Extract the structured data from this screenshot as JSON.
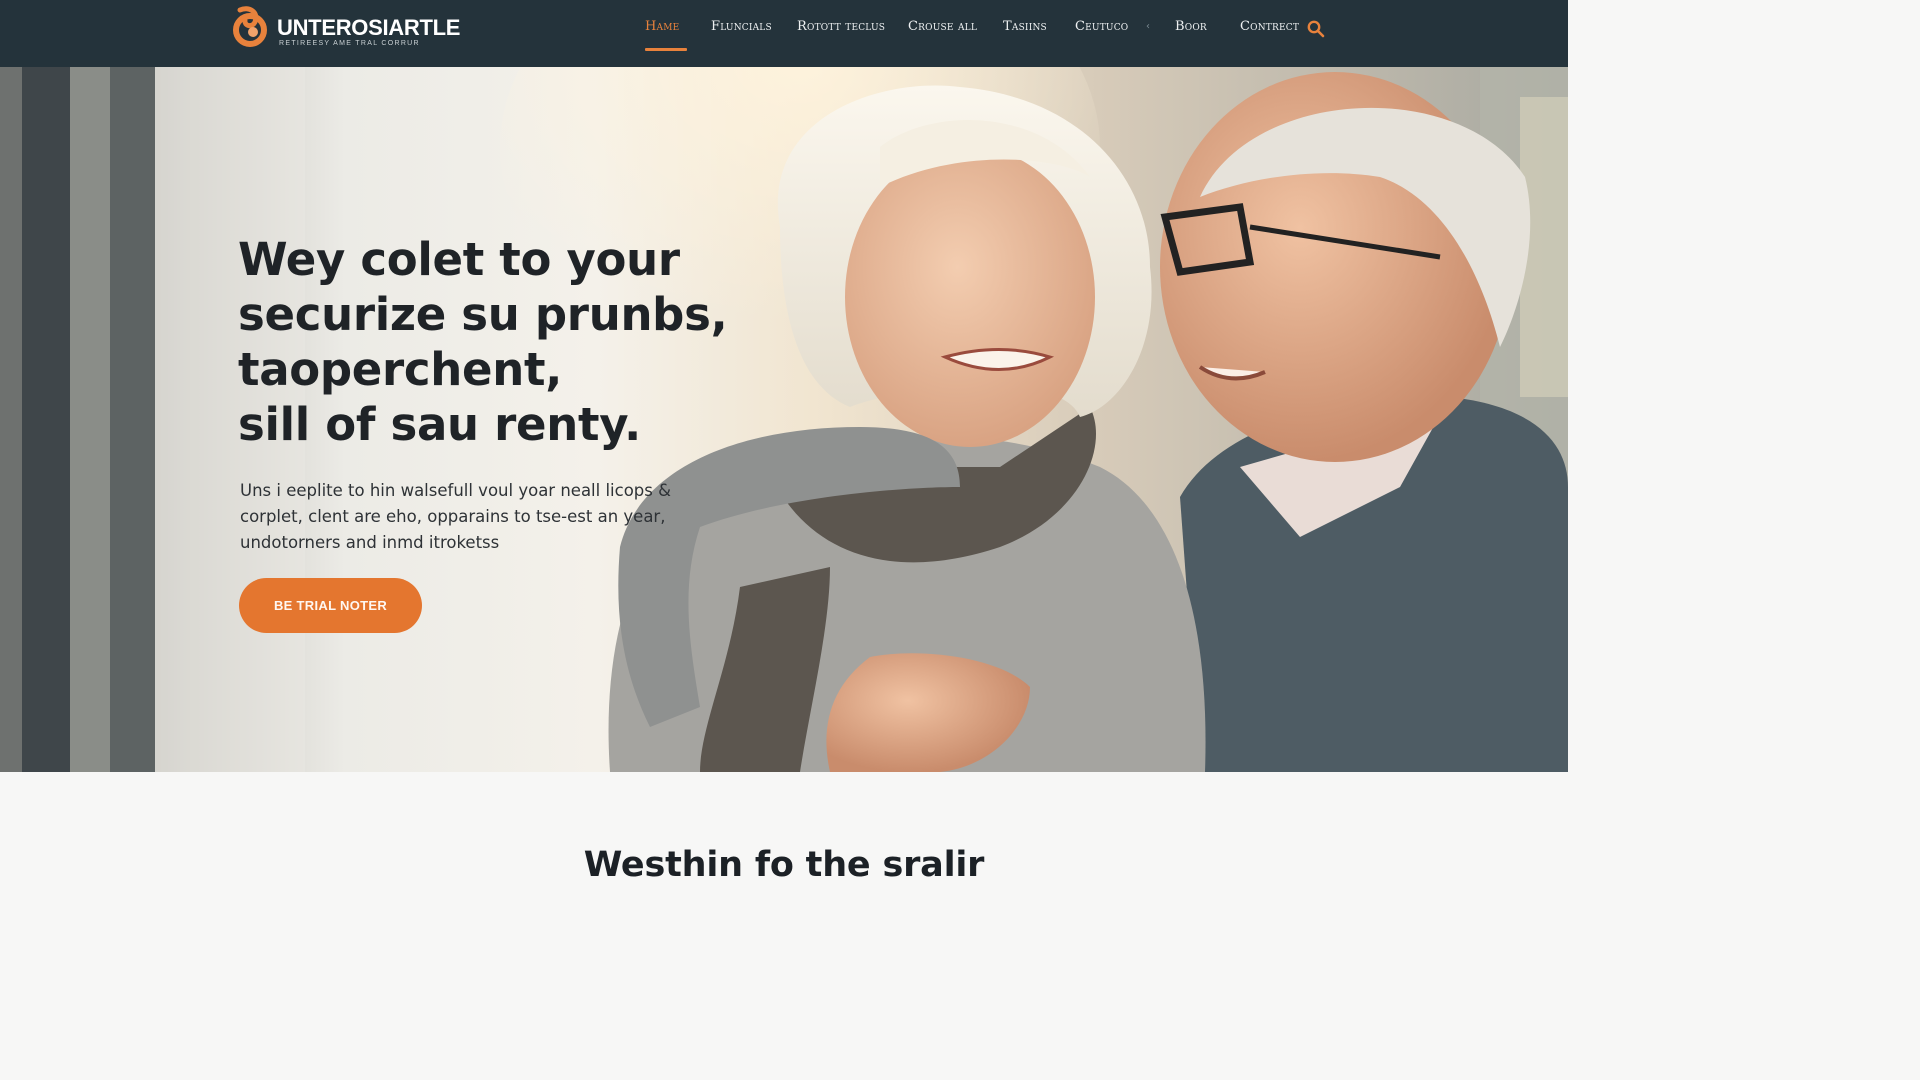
{
  "brand": {
    "name": "UNTEROSIARTLE",
    "tagline": "RETIREESY AME TRAL CORRUR",
    "accent_color": "#e8823c",
    "header_color": "#24333b"
  },
  "nav": {
    "items": [
      {
        "label": "Hame",
        "active": true
      },
      {
        "label": "Fluncials"
      },
      {
        "label": "Rotott teclus"
      },
      {
        "label": "Crouse all"
      },
      {
        "label": "Tasiins"
      },
      {
        "label": "Ceutuco"
      },
      {
        "label": "Boor"
      },
      {
        "label": "Contrect"
      }
    ],
    "separator": "‹",
    "search_icon": "search-icon"
  },
  "hero": {
    "title_lines": [
      "Wey colet to your",
      "securize su prunbs,",
      "taoperchent,",
      "sill of sau renty."
    ],
    "body_lines": [
      "Uns i eeplite to hin walsefull voul yoar neall licops   &",
      "corplet, clent are eho, opparains to tse-est an year,",
      "undotorners and inmd itroketss"
    ],
    "cta_label": "BE TRIAL NOTER",
    "image": "elderly-couple-hugging-photo"
  },
  "section": {
    "title": "Westhin fo the sralir"
  }
}
